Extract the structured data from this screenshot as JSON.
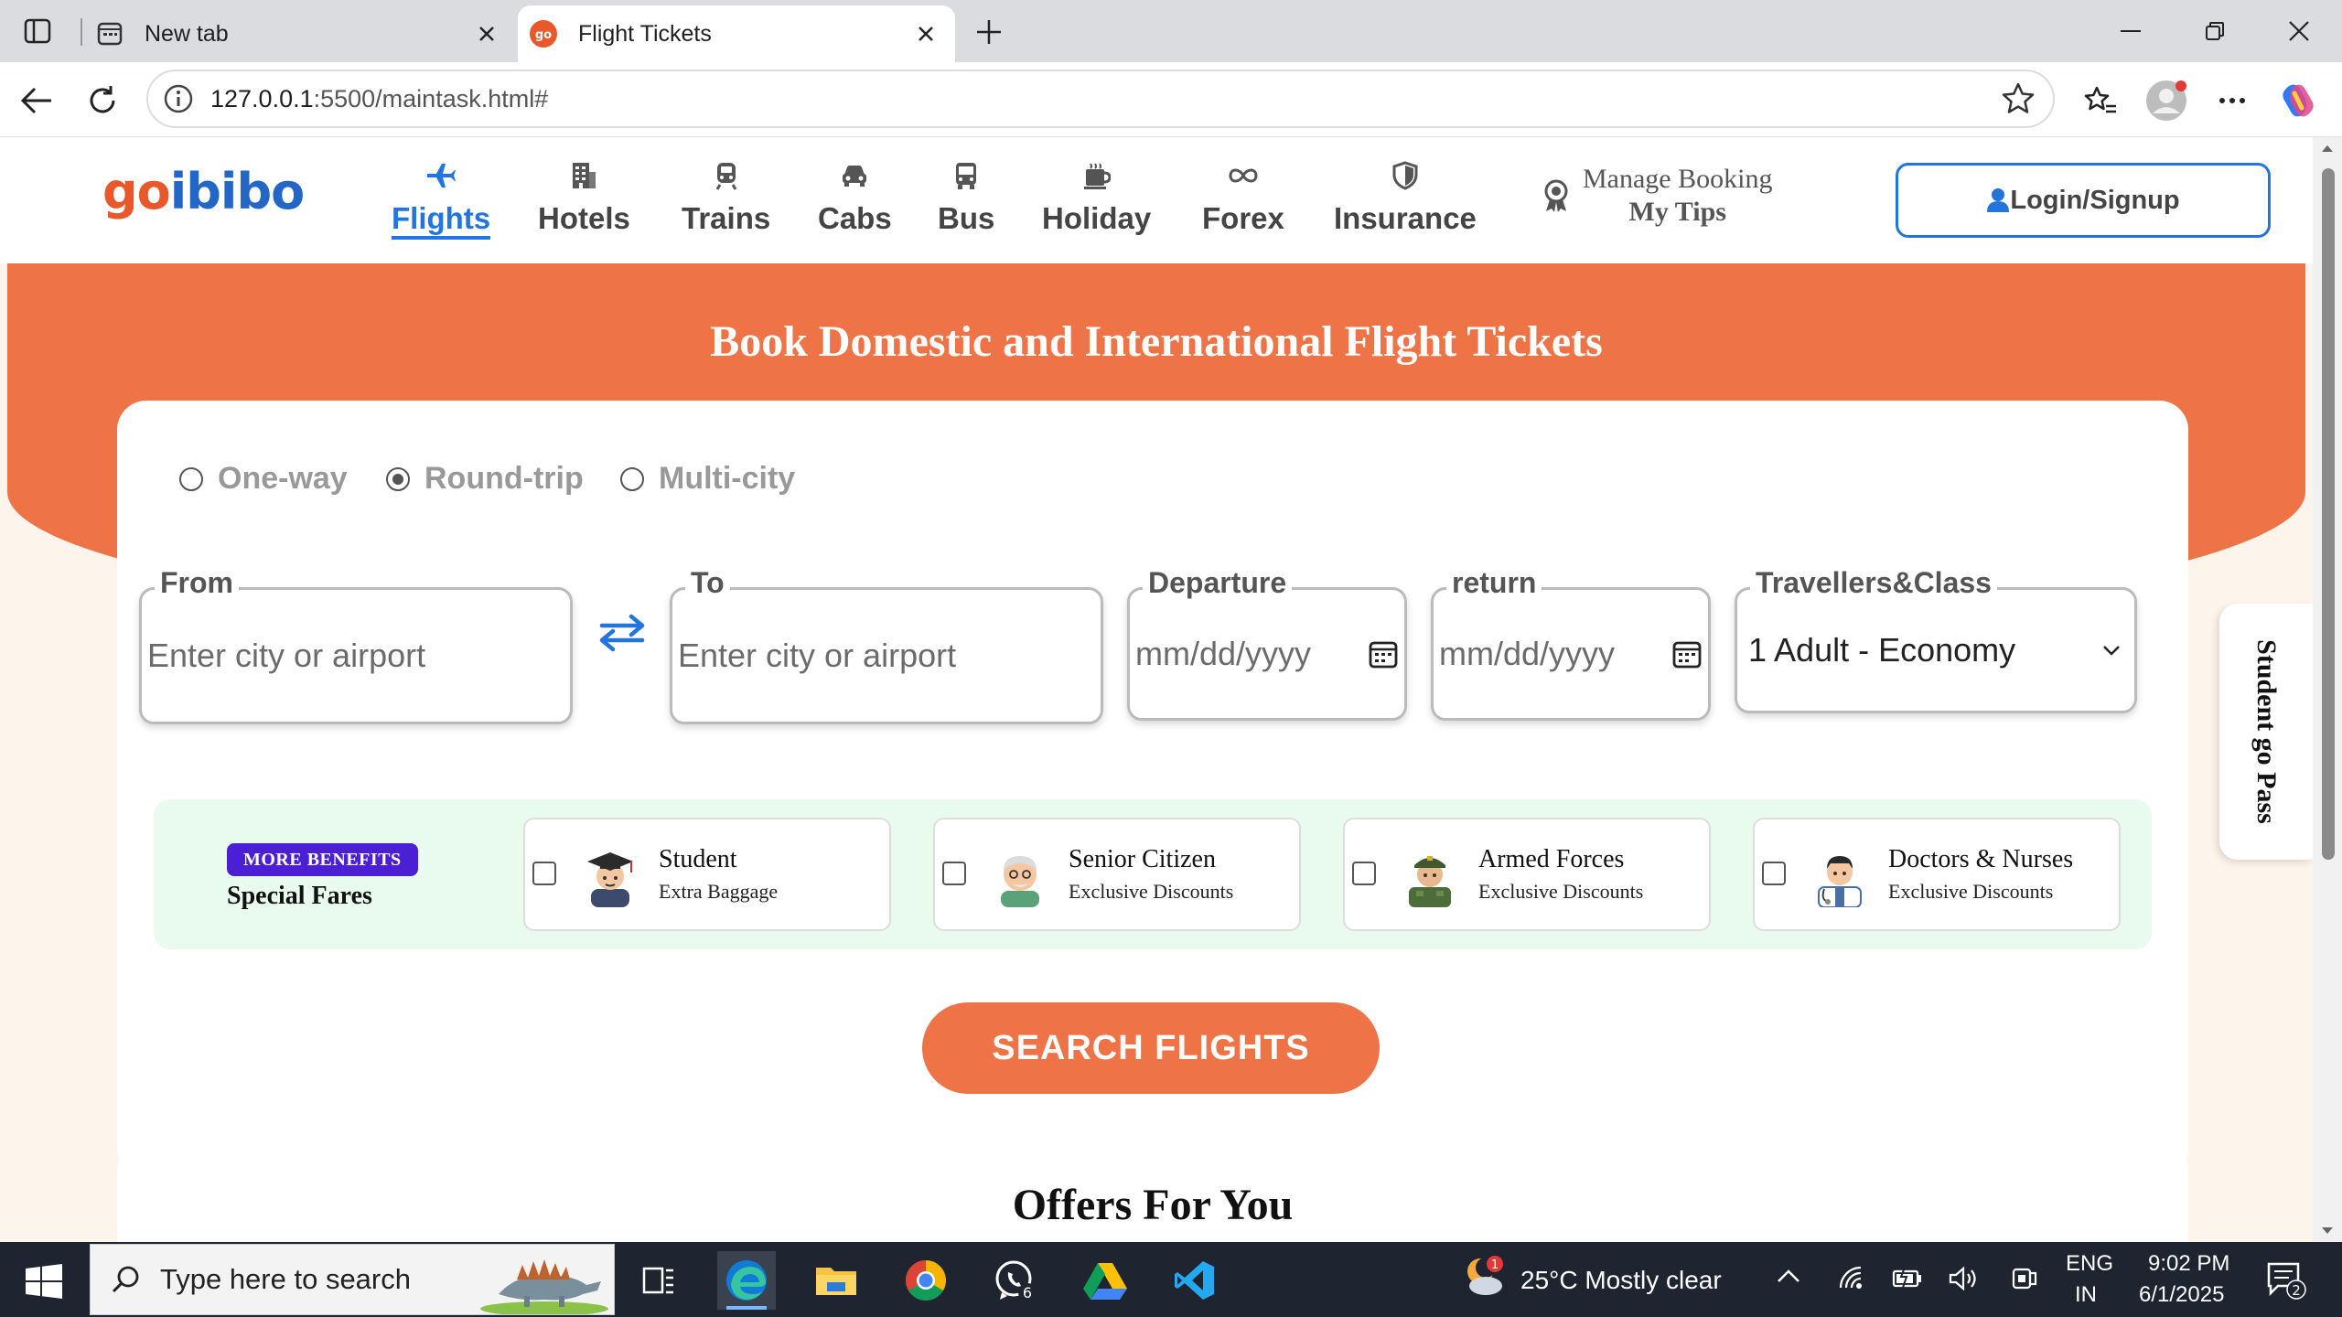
{
  "browser": {
    "tabs": [
      {
        "title": "New tab",
        "icon": "new-tab-page-icon"
      },
      {
        "title": "Flight Tickets",
        "icon": "goibibo-favicon"
      }
    ],
    "url_host": "127.0.0.1",
    "url_rest": ":5500/maintask.html#"
  },
  "site": {
    "logo_go": "go",
    "logo_ibibo": "ibibo",
    "nav": [
      {
        "label": "Flights",
        "icon": "plane-icon",
        "active": true
      },
      {
        "label": "Hotels",
        "icon": "building-icon"
      },
      {
        "label": "Trains",
        "icon": "train-icon"
      },
      {
        "label": "Cabs",
        "icon": "car-icon"
      },
      {
        "label": "Bus",
        "icon": "bus-icon"
      },
      {
        "label": "Holiday",
        "icon": "holiday-icon"
      },
      {
        "label": "Forex",
        "icon": "infinity-icon"
      },
      {
        "label": "Insurance",
        "icon": "shield-icon"
      }
    ],
    "manage_booking": "Manage Booking",
    "my_tips": "My Tips",
    "login": "Login/Signup"
  },
  "hero": {
    "title": "Book Domestic and International Flight Tickets"
  },
  "booking": {
    "trip_types": [
      {
        "label": "One-way",
        "selected": false
      },
      {
        "label": "Round-trip",
        "selected": true
      },
      {
        "label": "Multi-city",
        "selected": false
      }
    ],
    "from": {
      "legend": "From",
      "placeholder": "Enter city or airport"
    },
    "to": {
      "legend": "To",
      "placeholder": "Enter city or airport"
    },
    "departure": {
      "legend": "Departure",
      "placeholder": "mm/dd/yyyy"
    },
    "return": {
      "legend": "return",
      "placeholder": "mm/dd/yyyy"
    },
    "travellers": {
      "legend": "Travellers&Class",
      "value": "1 Adult - Economy"
    },
    "special_fares": {
      "badge": "MORE BENEFITS",
      "title": "Special Fares",
      "options": [
        {
          "name": "Student",
          "sub": "Extra Baggage",
          "icon": "student-avatar-icon"
        },
        {
          "name": "Senior Citizen",
          "sub": "Exclusive Discounts",
          "icon": "senior-avatar-icon"
        },
        {
          "name": "Armed Forces",
          "sub": "Exclusive Discounts",
          "icon": "soldier-avatar-icon"
        },
        {
          "name": "Doctors & Nurses",
          "sub": "Exclusive Discounts",
          "icon": "doctor-avatar-icon"
        }
      ]
    },
    "search_label": "SEARCH FLIGHTS"
  },
  "student_pass": "Student go Pass",
  "offers_title": "Offers For You",
  "taskbar": {
    "search_placeholder": "Type here to search",
    "weather": "25°C  Mostly clear",
    "weather_badge": "1",
    "lang_top": "ENG",
    "lang_bottom": "IN",
    "time": "9:02 PM",
    "date": "6/1/2025",
    "notifications": "2",
    "whatsapp_badge": "6"
  },
  "colors": {
    "accent_orange": "#ee7346",
    "brand_blue": "#2275dc",
    "logo_orange": "#e8582b",
    "logo_blue": "#2266c7"
  }
}
